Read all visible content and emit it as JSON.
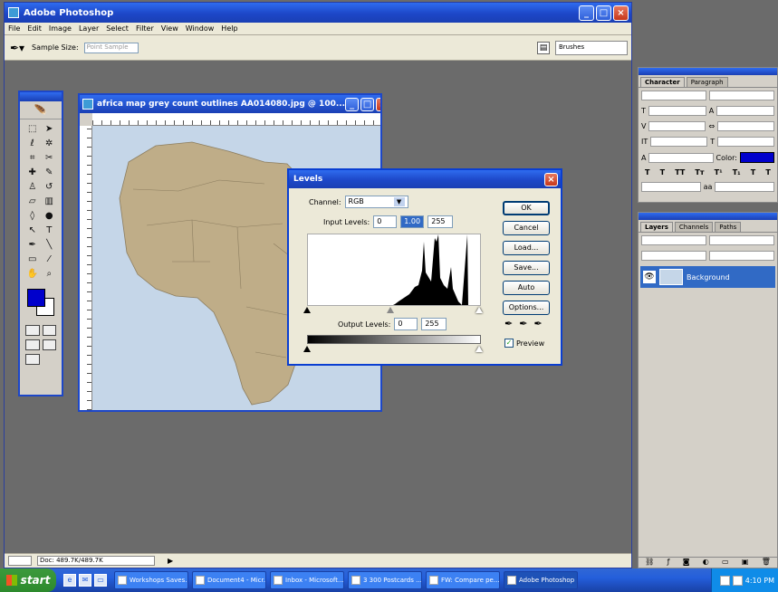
{
  "app": {
    "title": "Adobe Photoshop"
  },
  "menu": [
    "File",
    "Edit",
    "Image",
    "Layer",
    "Select",
    "Filter",
    "View",
    "Window",
    "Help"
  ],
  "options": {
    "tool_icon": "eyedropper-icon",
    "sample_label": "Sample Size:",
    "sample_value": "Point Sample",
    "palette_well_label": "Brushes"
  },
  "status": {
    "zoom": "100%",
    "doc": "Doc: 489.7K/489.7K"
  },
  "document": {
    "title": "africa map grey count outlines AA014080.jpg @ 100...",
    "canvas_bg": "#c5d6e8",
    "land_color": "#bfad88"
  },
  "levels": {
    "title": "Levels",
    "channel_label": "Channel:",
    "channel_value": "RGB",
    "input_label": "Input Levels:",
    "input_black": "0",
    "input_mid": "1.00",
    "input_white": "255",
    "output_label": "Output Levels:",
    "output_black": "0",
    "output_white": "255",
    "buttons": {
      "ok": "OK",
      "cancel": "Cancel",
      "load": "Load...",
      "save": "Save...",
      "auto": "Auto",
      "options": "Options..."
    },
    "preview_label": "Preview",
    "preview_checked": true
  },
  "palettes": {
    "char_tabs": [
      "Character",
      "Paragraph"
    ],
    "color_label": "Color:",
    "layer_tabs": [
      "Layers",
      "Channels",
      "Paths"
    ],
    "layer_name": "Background"
  },
  "taskbar": {
    "start": "start",
    "tasks": [
      {
        "label": "Workshops Saves...",
        "active": false
      },
      {
        "label": "Document4 - Micr...",
        "active": false
      },
      {
        "label": "Inbox - Microsoft...",
        "active": false
      },
      {
        "label": "3 300 Postcards ...",
        "active": false
      },
      {
        "label": "FW: Compare pe...",
        "active": false
      },
      {
        "label": "Adobe Photoshop",
        "active": true
      }
    ],
    "clock": "4:10 PM"
  }
}
